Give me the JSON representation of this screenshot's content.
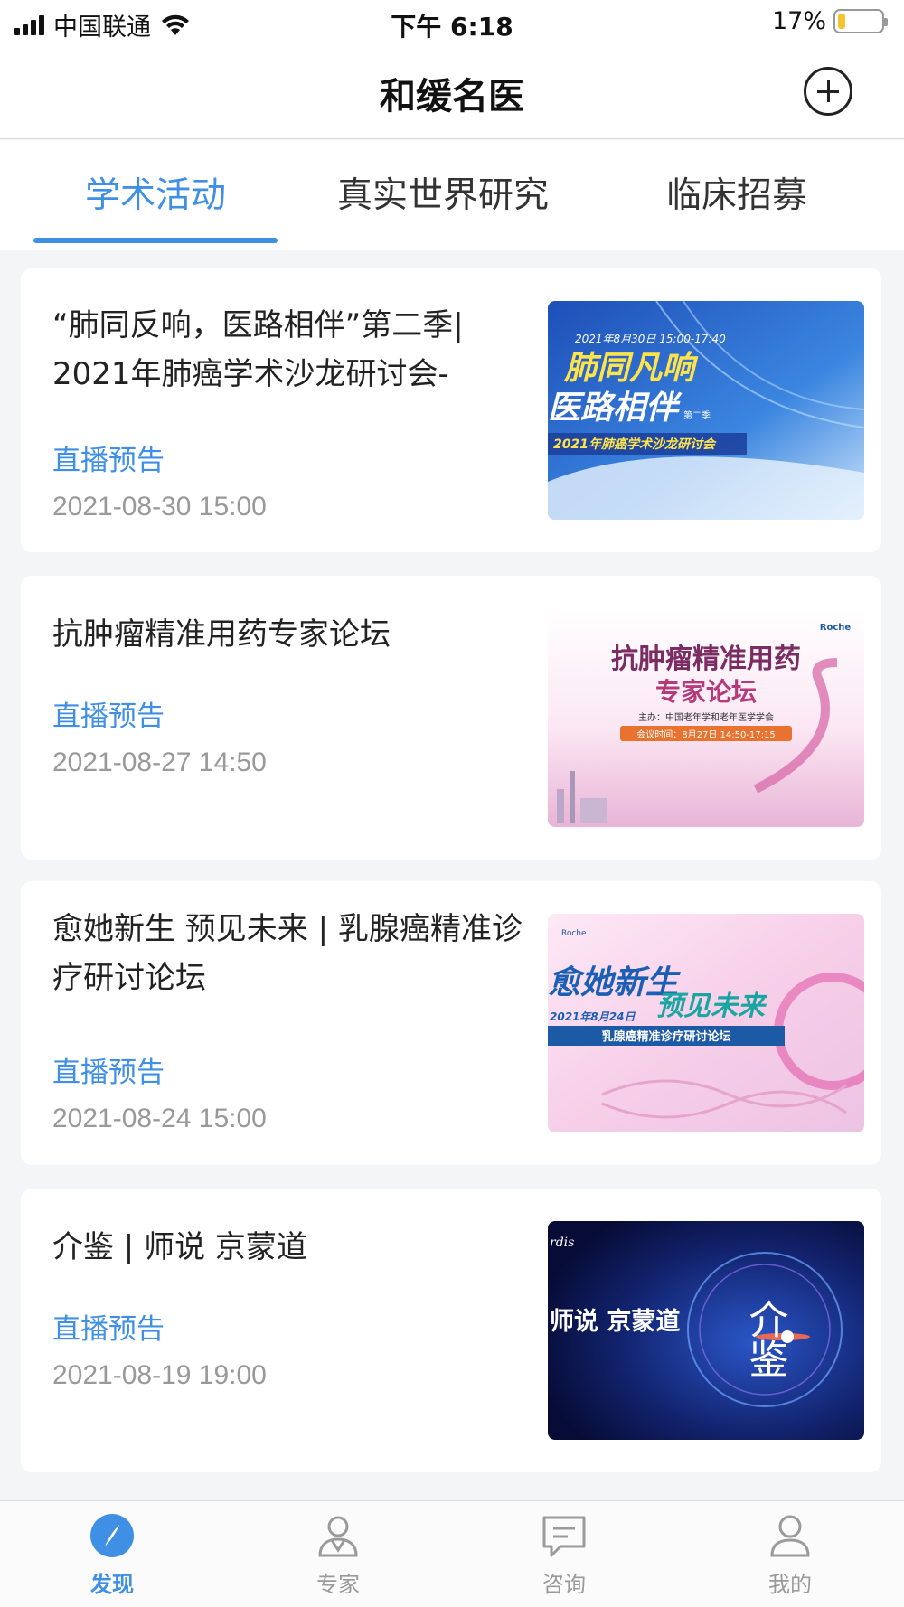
{
  "status_bar": {
    "carrier": "中国联通",
    "time": "下午 6:18",
    "battery_percent": "17%",
    "battery_level": 0.17
  },
  "header": {
    "title": "和缓名医",
    "add_icon": "plus-circle-icon"
  },
  "tabs": [
    {
      "label": "学术活动",
      "active": true
    },
    {
      "label": "真实世界研究",
      "active": false
    },
    {
      "label": "临床招募",
      "active": false
    }
  ],
  "cards": [
    {
      "title": "“肺同反响，医路相伴”第二季| 2021年肺癌学术沙龙研讨会-",
      "status": "直播预告",
      "date": "2021-08-30 15:00",
      "image": {
        "date_line": "2021年8月30日 15:00-17:40",
        "headline1": "肺同凡响",
        "headline2": "医路相伴",
        "subtitle": "2021年肺癌学术沙龙研讨会",
        "season": "第二季"
      }
    },
    {
      "title": "抗肿瘤精准用药专家论坛",
      "status": "直播预告",
      "date": "2021-08-27 14:50",
      "image": {
        "headline1": "抗肿瘤精准用药",
        "headline2": "专家论坛",
        "host": "主办：中国老年学和老年医学学会",
        "meeting_time": "会议时间：8月27日 14:50-17:15",
        "brand": "Roche"
      }
    },
    {
      "title": "愈她新生  预见未来 | 乳腺癌精准诊疗研讨论坛",
      "status": "直播预告",
      "date": "2021-08-24 15:00",
      "image": {
        "headline1": "愈她新生",
        "headline2": "预见未来",
        "date_line": "2021年8月24日",
        "subtitle": "乳腺癌精准诊疗研讨论坛",
        "brand": "Roche"
      }
    },
    {
      "title": "介鉴 | 师说 京蒙道",
      "status": "直播预告",
      "date": "2021-08-19 19:00",
      "image": {
        "headline": "师说 京蒙道",
        "calligraphy": "介鉴",
        "brand": "rdis"
      }
    }
  ],
  "tab_bar": [
    {
      "label": "发现",
      "icon": "compass-icon",
      "active": true
    },
    {
      "label": "专家",
      "icon": "doctor-icon",
      "active": false
    },
    {
      "label": "咨询",
      "icon": "chat-icon",
      "active": false
    },
    {
      "label": "我的",
      "icon": "user-icon",
      "active": false
    }
  ],
  "colors": {
    "accent": "#3f8fe5",
    "background": "#f4f5f7",
    "muted_text": "#999999"
  }
}
